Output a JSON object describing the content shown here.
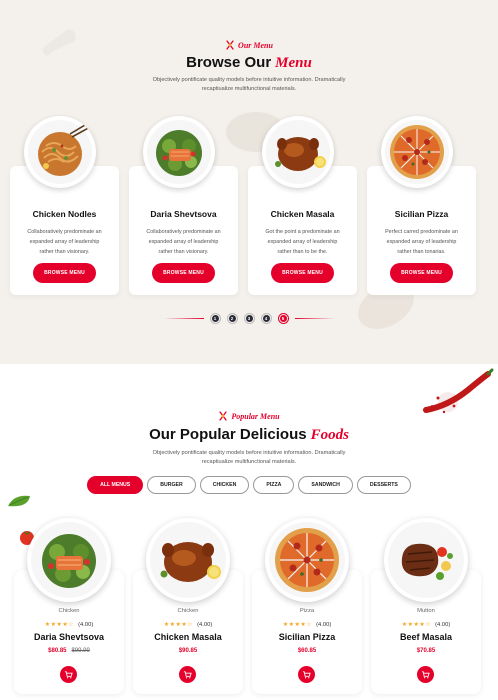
{
  "browse": {
    "tag": "Our Menu",
    "title_main": "Browse Our",
    "title_accent": "Menu",
    "desc_line1": "Objectively pontificate quality models before intuitive information. Dramatically",
    "desc_line2": "recaptiualize multifunctional materials.",
    "cards": [
      {
        "name": "Chicken Nodles",
        "desc_lines": [
          "Collaboratively predominate an",
          "expanded array of leadership",
          "rather than visionary."
        ],
        "button": "BROWSE MENU",
        "icon": "noodle-plate-image"
      },
      {
        "name": "Daria Shevtsova",
        "desc_lines": [
          "Collaboratively predominate an",
          "expanded array of leadership",
          "rather than visionary."
        ],
        "button": "BROWSE MENU",
        "icon": "salmon-salad-plate-image"
      },
      {
        "name": "Chicken Masala",
        "desc_lines": [
          "Got the point a predominate an",
          "expanded array of leadership",
          "rather than to be the."
        ],
        "button": "BROWSE MENU",
        "icon": "roast-chicken-plate-image"
      },
      {
        "name": "Sicilian Pizza",
        "desc_lines": [
          "Perfect carred predominate an",
          "expanded array of leadership",
          "rather than tonarias."
        ],
        "button": "BROWSE MENU",
        "icon": "pizza-plate-image"
      }
    ],
    "pager": [
      "1",
      "2",
      "3",
      "4",
      "5"
    ],
    "pager_active": 4
  },
  "popular": {
    "tag": "Popular Menu",
    "title_main": "Our Popular Delicious",
    "title_accent": "Foods",
    "desc_line1": "Objectively pontificate quality models before intuitive information. Dramatically",
    "desc_line2": "recaptiualize multifunctional materials.",
    "filters": [
      "ALL MENUS",
      "BURGER",
      "CHICKEN",
      "PIZZA",
      "SANDWICH",
      "DESSERTS"
    ],
    "active_filter": 0,
    "cards": [
      {
        "category": "Chicken",
        "rating": "(4.00)",
        "stars": 4,
        "name": "Daria Shevtsova",
        "price": "$80.85",
        "old_price": "$99.99",
        "icon": "salmon-salad-plate-image"
      },
      {
        "category": "Chicken",
        "rating": "(4.00)",
        "stars": 4,
        "name": "Chicken Masala",
        "price": "$90.85",
        "old_price": "",
        "icon": "roast-chicken-plate-image"
      },
      {
        "category": "Pizza",
        "rating": "(4.00)",
        "stars": 4,
        "name": "Sicilian Pizza",
        "price": "$60.85",
        "old_price": "",
        "icon": "pizza-plate-image"
      },
      {
        "category": "Mutton",
        "rating": "(4.00)",
        "stars": 4,
        "name": "Beef Masala",
        "price": "$70.85",
        "old_price": "",
        "icon": "beef-steak-plate-image"
      }
    ]
  },
  "colors": {
    "accent": "#e4002b",
    "cream_bg": "#f4f1ec",
    "star": "#f5a623",
    "dark": "#111111"
  }
}
